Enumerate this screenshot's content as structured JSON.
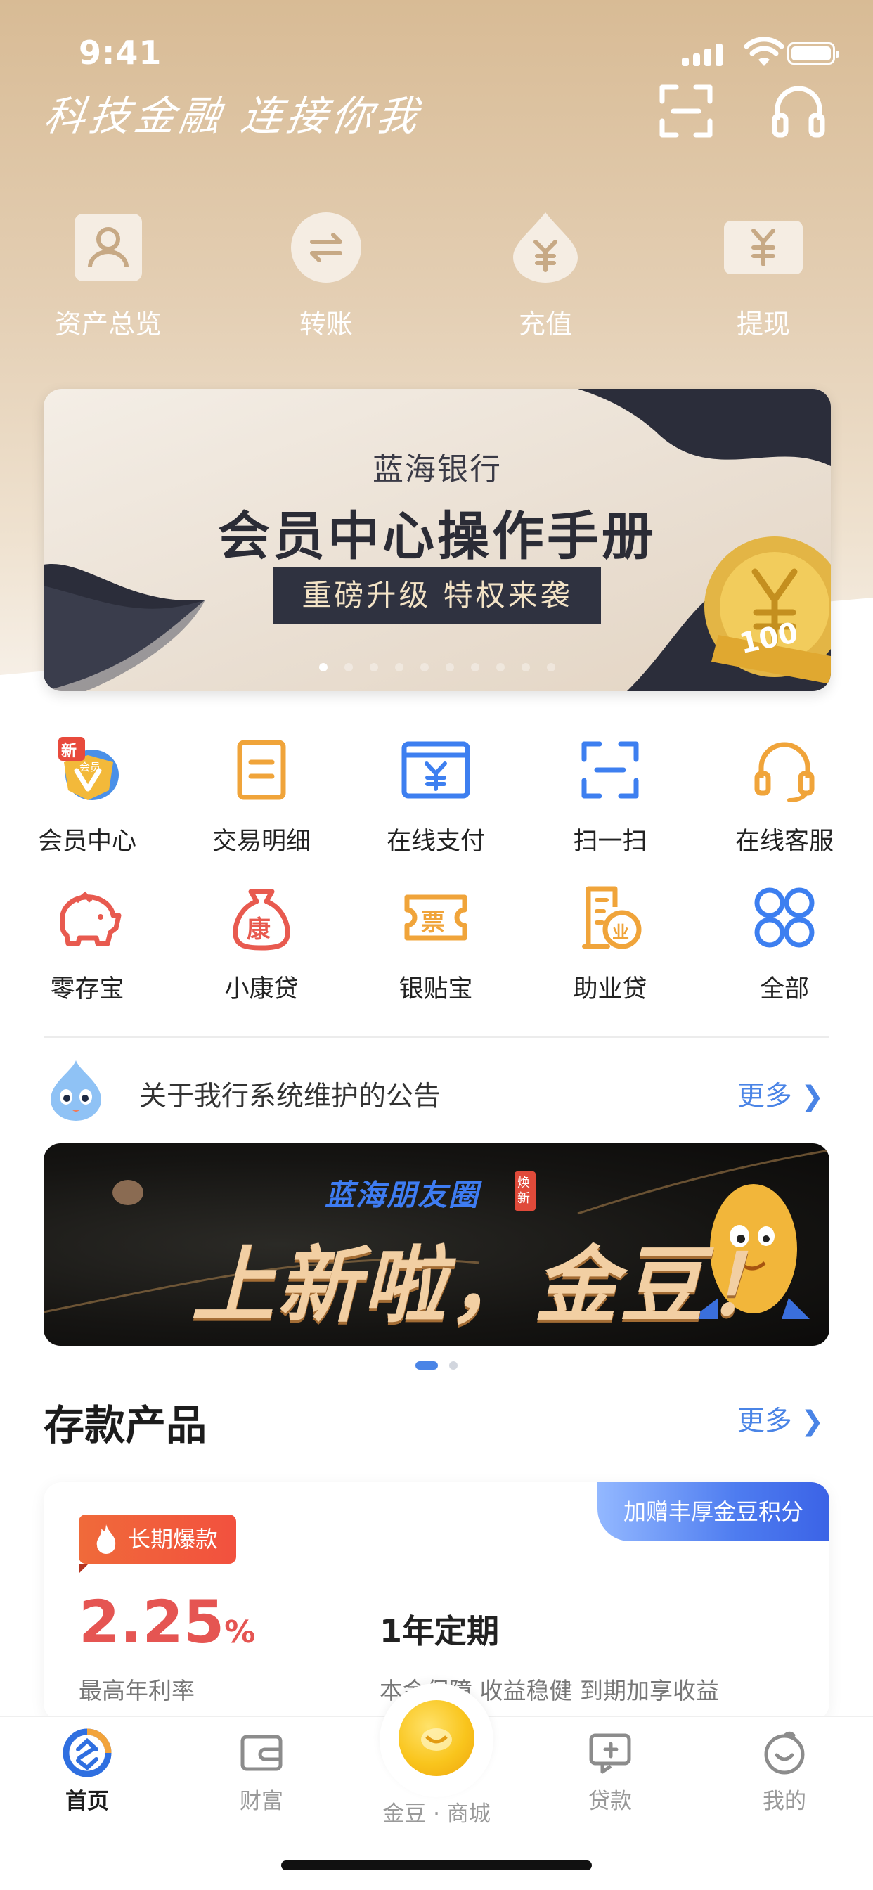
{
  "status_bar": {
    "time": "9:41"
  },
  "header": {
    "slogan": "科技金融 连接你我",
    "scan_icon": "scan-icon",
    "service_icon": "headset-icon"
  },
  "quick_actions": [
    {
      "label": "资产总览",
      "icon": "person-icon"
    },
    {
      "label": "转账",
      "icon": "transfer-icon"
    },
    {
      "label": "充值",
      "icon": "yuan-drop-icon"
    },
    {
      "label": "提现",
      "icon": "yuan-card-icon"
    }
  ],
  "banner": {
    "subtitle": "蓝海银行",
    "title": "会员中心操作手册",
    "tag": "重磅升级 特权来袭",
    "coin_text": "100",
    "slide_count": 10,
    "active_slide": 1
  },
  "services": [
    {
      "label": "会员中心",
      "icon": "vip-badge-icon",
      "badge": "新",
      "badge_sub": "会员"
    },
    {
      "label": "交易明细",
      "icon": "bill-icon"
    },
    {
      "label": "在线支付",
      "icon": "payment-card-icon"
    },
    {
      "label": "扫一扫",
      "icon": "scan-icon"
    },
    {
      "label": "在线客服",
      "icon": "headset-icon"
    },
    {
      "label": "零存宝",
      "icon": "piggy-bank-icon"
    },
    {
      "label": "小康贷",
      "icon": "money-bag-icon",
      "glyph": "康"
    },
    {
      "label": "银贴宝",
      "icon": "ticket-icon",
      "glyph": "票"
    },
    {
      "label": "助业贷",
      "icon": "business-loan-icon",
      "glyph": "业"
    },
    {
      "label": "全部",
      "icon": "all-apps-icon"
    }
  ],
  "notice": {
    "text": "关于我行系统维护的公告",
    "more": "更多",
    "icon": "mascot-icon"
  },
  "promo": {
    "title": "蓝海朋友圈",
    "badge": "焕新",
    "headline": "上新啦，金豆！",
    "slide_count": 2,
    "active_slide": 1
  },
  "deposit_section": {
    "title": "存款产品",
    "more": "更多",
    "product": {
      "ribbon": "加赠丰厚金豆积分",
      "tag": "长期爆款",
      "rate": "2.25",
      "rate_unit": "%",
      "rate_label": "最高年利率",
      "name": "1年定期",
      "desc": "本金保障 收益稳健 到期加享收益"
    }
  },
  "tab_bar": {
    "items": [
      {
        "label": "首页",
        "icon": "home-logo-icon",
        "active": true
      },
      {
        "label": "财富",
        "icon": "wallet-icon",
        "active": false
      },
      {
        "label": "金豆 · 商城",
        "icon": "gold-bean-icon",
        "active": false
      },
      {
        "label": "贷款",
        "icon": "loan-icon",
        "active": false
      },
      {
        "label": "我的",
        "icon": "profile-face-icon",
        "active": false
      }
    ]
  },
  "colors": {
    "accent": "#4a84e6",
    "rate": "#e55552",
    "hero_top": "#d8bb95"
  }
}
